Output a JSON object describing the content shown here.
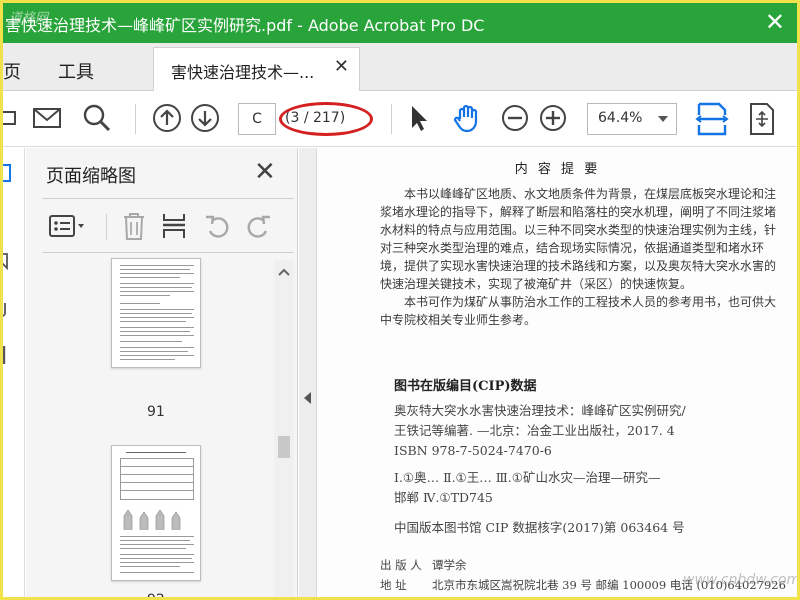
{
  "window": {
    "title": "害快速治理技术—峰峰矿区实例研究.pdf - Adobe Acrobat Pro DC",
    "watermark": "道格网",
    "close_glyph": "✕"
  },
  "menu": {
    "home_partial": "页",
    "tools": "工具"
  },
  "tab": {
    "label": "害快速治理技术—...",
    "close_glyph": "✕"
  },
  "toolbar": {
    "page_input": "C",
    "page_count": "(3 / 217)",
    "zoom": "64.4%"
  },
  "colors": {
    "accent": "#28a43a",
    "toolbar_icon": "#1473e6",
    "highlight": "#d42020",
    "frame": "#f0e24a"
  },
  "thumbnail_panel": {
    "title": "页面缩略图",
    "close_glyph": "✕",
    "pages": [
      {
        "label": "91"
      },
      {
        "label": "92"
      }
    ]
  },
  "document": {
    "heading": "内 容 提 要",
    "para1": "本书以峰峰矿区地质、水文地质条件为背景，在煤层底板突水理论和注浆堵水理论的指导下，解释了断层和陷落柱的突水机理，阐明了不同注浆堵水材料的特点与应用范围。以三种不同突水类型的快速治理实例为主线，针对三种突水类型治理的难点，结合现场实际情况，依据通道类型和堵水环境，提供了实现水害快速治理的技术路线和方案，以及奥灰特大突水水害的快速治理关键技术，实现了被淹矿井（采区）的快速恢复。",
    "para2": "本书可作为煤矿从事防治水工作的工程技术人员的参考用书，也可供大中专院校相关专业师生参考。",
    "cip_title": "图书在版编目(CIP)数据",
    "cip_line1": "奥灰特大突水水害快速治理技术：峰峰矿区实例研究/",
    "cip_line2": "王铁记等编著. —北京：冶金工业出版社，2017. 4",
    "cip_isbn": "ISBN 978-7-5024-7470-6",
    "cip_class1": "Ⅰ.①奥…   Ⅱ.①王…   Ⅲ.①矿山水灾—治理—研究—",
    "cip_class2": "邯郸   Ⅳ.①TD745",
    "cip_number": "中国版本图书馆 CIP 数据核字(2017)第 063464 号",
    "pub_label1": "出 版 人",
    "pub_value1": "谭学余",
    "pub_label2": "地    址",
    "pub_value2": "北京市东城区嵩祝院北巷 39 号    邮编  100009    电话 (010)64027926",
    "site_watermark": "www.cnbdw.com"
  }
}
